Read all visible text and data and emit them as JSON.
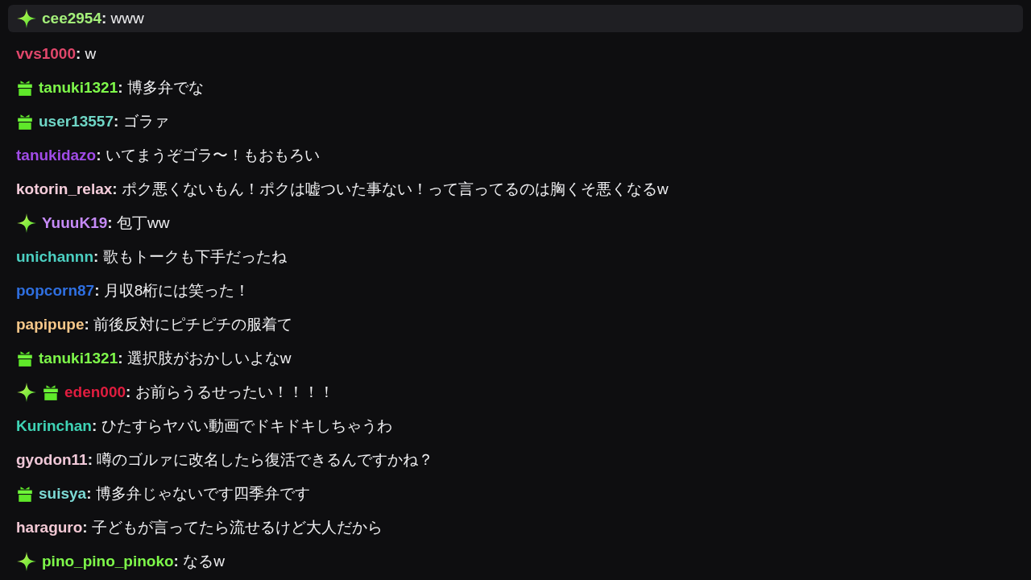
{
  "chat": {
    "messages": [
      {
        "user": "cee2954",
        "color": "#a4f07a",
        "separator": ":",
        "message": "www",
        "highlighted": true,
        "badges": [
          {
            "kind": "sparkle"
          }
        ]
      },
      {
        "user": "vvs1000",
        "color": "#e0476b",
        "separator": ":",
        "message": "w",
        "highlighted": false
      },
      {
        "user": "tanuki1321",
        "color": "#7ef84a",
        "separator": ":",
        "message": "博多弁でな",
        "highlighted": false,
        "badges": [
          {
            "kind": "gift"
          }
        ]
      },
      {
        "user": "user13557",
        "color": "#6fd6c6",
        "separator": ":",
        "message": "ゴラァ",
        "highlighted": false,
        "badges": [
          {
            "kind": "gift"
          }
        ]
      },
      {
        "user": "tanukidazo",
        "color": "#a14ce8",
        "separator": ":",
        "message": "いてまうぞゴラ〜！もおもろい",
        "highlighted": false
      },
      {
        "user": "kotorin_relax",
        "color": "#f6cddb",
        "separator": ":",
        "message": "ポク悪くないもん！ポクは嘘ついた事ない！って言ってるのは胸くそ悪くなるw",
        "highlighted": false
      },
      {
        "user": "YuuuK19",
        "color": "#c58af6",
        "separator": ":",
        "message": "包丁ww",
        "highlighted": false,
        "badges": [
          {
            "kind": "sparkle"
          }
        ]
      },
      {
        "user": "unichannn",
        "color": "#4ccfc1",
        "separator": ":",
        "message": "歌もトークも下手だったね",
        "highlighted": false
      },
      {
        "user": "popcorn87",
        "color": "#2f6fe0",
        "separator": ":",
        "message": "月収8桁には笑った！",
        "highlighted": false
      },
      {
        "user": "papipupe",
        "color": "#f7c88a",
        "separator": ":",
        "message": "前後反対にピチピチの服着て",
        "highlighted": false
      },
      {
        "user": "tanuki1321",
        "color": "#7ef84a",
        "separator": ":",
        "message": "選択肢がおかしいよなw",
        "highlighted": false,
        "badges": [
          {
            "kind": "gift"
          }
        ]
      },
      {
        "user": "eden000",
        "color": "#e01d3f",
        "separator": ":",
        "message": "お前らうるせったい！！！！",
        "highlighted": false,
        "badges": [
          {
            "kind": "sparkle"
          },
          {
            "kind": "gift"
          }
        ]
      },
      {
        "user": "Kurinchan",
        "color": "#3fd3b5",
        "separator": ":",
        "message": "ひたすらヤバい動画でドキドキしちゃうわ",
        "highlighted": false
      },
      {
        "user": "gyodon11",
        "color": "#f0c8d8",
        "separator": ":",
        "message": "噂のゴルァに改名したら復活できるんですかね？",
        "highlighted": false
      },
      {
        "user": "suisya",
        "color": "#7cd9d4",
        "separator": ":",
        "message": "博多弁じゃないです四季弁です",
        "highlighted": false,
        "badges": [
          {
            "kind": "gift"
          }
        ]
      },
      {
        "user": "haraguro",
        "color": "#f3c9d5",
        "separator": ":",
        "message": "子どもが言ってたら流せるけど大人だから",
        "highlighted": false
      },
      {
        "user": "pino_pino_pinoko",
        "color": "#7ef84a",
        "separator": ":",
        "message": "なるw",
        "highlighted": false,
        "badges": [
          {
            "kind": "sparkle"
          }
        ]
      }
    ]
  }
}
